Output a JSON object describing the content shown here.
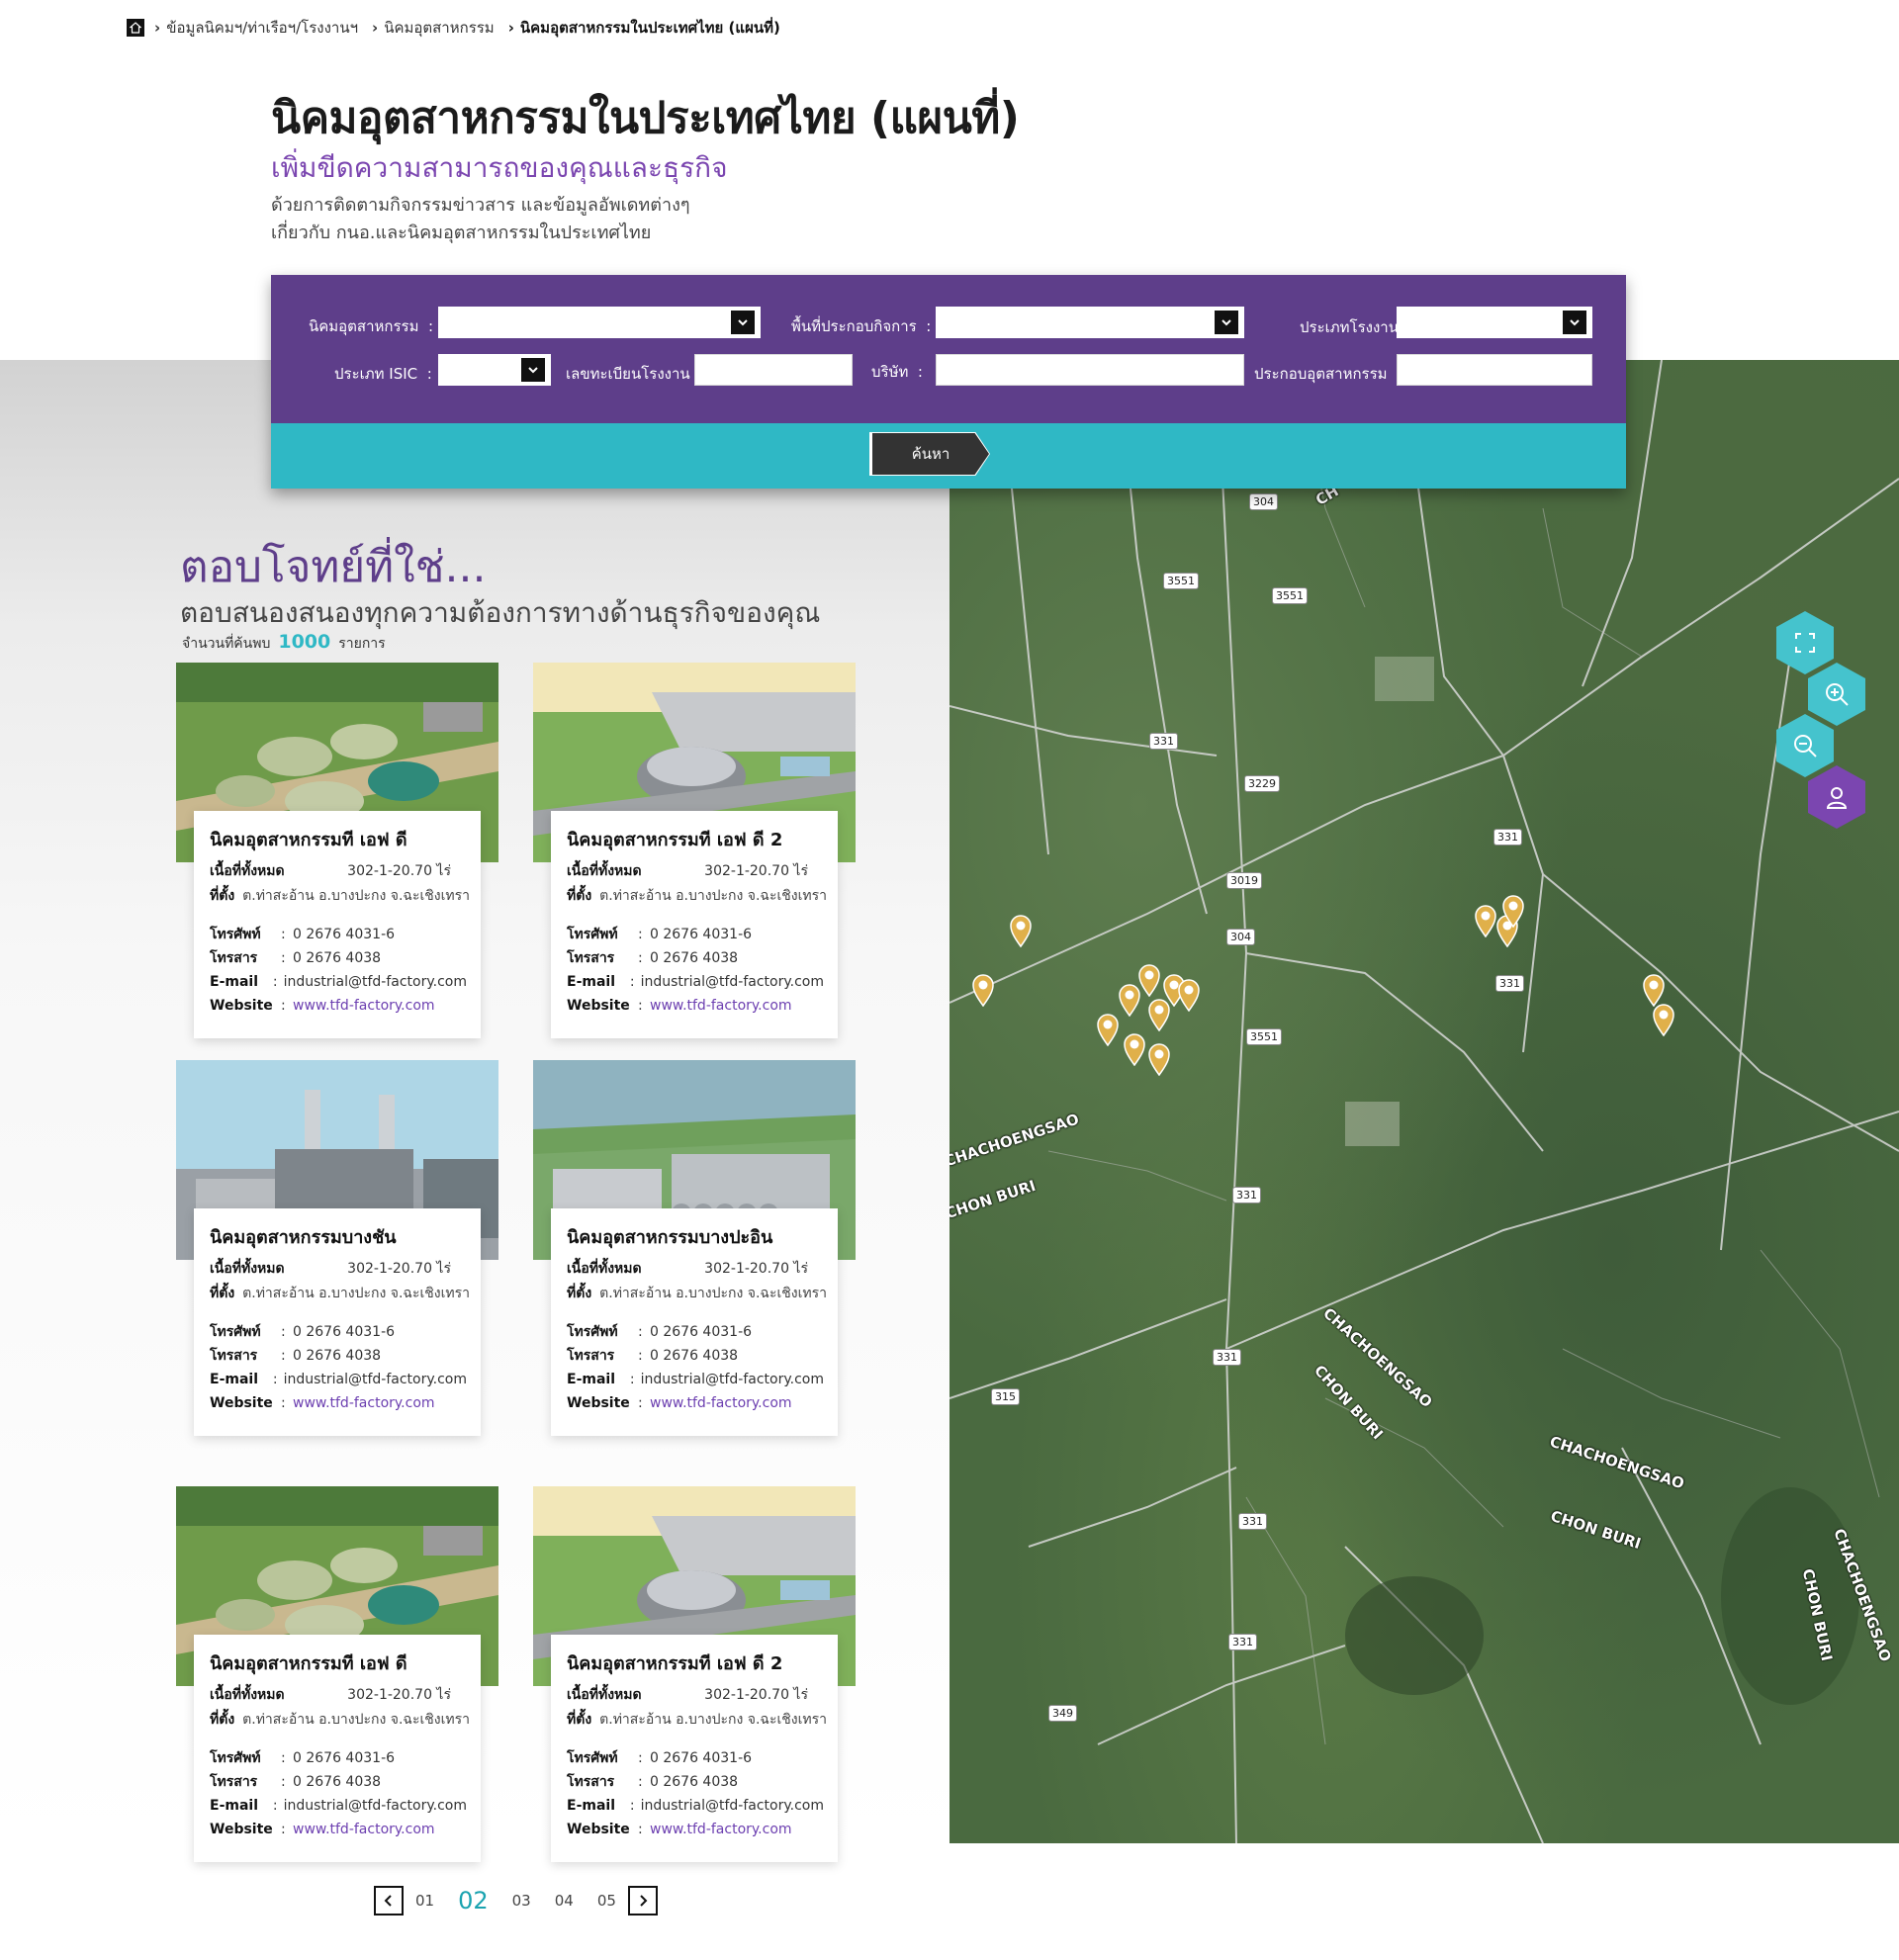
{
  "breadcrumb": {
    "items": [
      {
        "label": "ข้อมูลนิคมฯ/ท่าเรือฯ/โรงงานฯ"
      },
      {
        "label": "นิคมอุตสาหกรรม"
      },
      {
        "label": "นิคมอุตสาหกรรมในประเทศไทย (แผนที่)"
      }
    ]
  },
  "header": {
    "title": "นิคมอุตสาหกรรมในประเทศไทย (แผนที่)",
    "subtitle": "เพิ่มขีดความสามารถของคุณและธุรกิจ",
    "desc_line1": "ด้วยการติดตามกิจกรรมข่าวสาร และข้อมูลอัพเดทต่างๆ",
    "desc_line2": "เกี่ยวกับ กนอ.และนิคมอุตสาหกรรมในประเทศไทย"
  },
  "search": {
    "estate_label": "นิคมอุตสาหกรรม",
    "zone_label": "พื้นที่ประกอบกิจการ",
    "factory_type_label": "ประเภทโรงงาน",
    "isic_label": "ประเภท ISIC",
    "factory_reg_label": "เลขทะเบียนโรงงาน",
    "company_label": "บริษัท",
    "industry_label": "ประกอบอุตสาหกรรม",
    "colon": ":",
    "button_label": "ค้นหา"
  },
  "results": {
    "title": "ตอบโจทย์ที่ใช่...",
    "subtitle": "ตอบสนองสนองทุกความต้องการทางด้านธุรกิจของคุณ",
    "count_prefix": "จำนวนที่ค้นพบ",
    "count": "1000",
    "count_suffix": "รายการ"
  },
  "card_labels": {
    "area": "เนื้อที่ทั้งหมด",
    "location": "ที่ตั้ง",
    "phone": "โทรศัพท์",
    "fax": "โทรสาร",
    "email": "E-mail",
    "website": "Website",
    "sep": ":"
  },
  "cards": [
    {
      "name": "นิคมอุตสาหกรรมที เอฟ ดี",
      "area": "302-1-20.70 ไร่",
      "location": "ต.ท่าสะอ้าน อ.บางปะกง จ.ฉะเชิงเทรา",
      "phone": "0 2676 4031-6",
      "fax": "0 2676 4038",
      "email": "industrial@tfd-factory.com",
      "website": "www.tfd-factory.com"
    },
    {
      "name": "นิคมอุตสาหกรรมที เอฟ ดี 2",
      "area": "302-1-20.70 ไร่",
      "location": "ต.ท่าสะอ้าน อ.บางปะกง จ.ฉะเชิงเทรา",
      "phone": "0 2676 4031-6",
      "fax": "0 2676 4038",
      "email": "industrial@tfd-factory.com",
      "website": "www.tfd-factory.com"
    },
    {
      "name": "นิคมอุตสาหกรรมบางชัน",
      "area": "302-1-20.70 ไร่",
      "location": "ต.ท่าสะอ้าน อ.บางปะกง จ.ฉะเชิงเทรา",
      "phone": "0 2676 4031-6",
      "fax": "0 2676 4038",
      "email": "industrial@tfd-factory.com",
      "website": "www.tfd-factory.com"
    },
    {
      "name": "นิคมอุตสาหกรรมบางปะอิน",
      "area": "302-1-20.70 ไร่",
      "location": "ต.ท่าสะอ้าน อ.บางปะกง จ.ฉะเชิงเทรา",
      "phone": "0 2676 4031-6",
      "fax": "0 2676 4038",
      "email": "industrial@tfd-factory.com",
      "website": "www.tfd-factory.com"
    },
    {
      "name": "นิคมอุตสาหกรรมที เอฟ ดี",
      "area": "302-1-20.70 ไร่",
      "location": "ต.ท่าสะอ้าน อ.บางปะกง จ.ฉะเชิงเทรา",
      "phone": "0 2676 4031-6",
      "fax": "0 2676 4038",
      "email": "industrial@tfd-factory.com",
      "website": "www.tfd-factory.com"
    },
    {
      "name": "นิคมอุตสาหกรรมที เอฟ ดี 2",
      "area": "302-1-20.70 ไร่",
      "location": "ต.ท่าสะอ้าน อ.บางปะกง จ.ฉะเชิงเทรา",
      "phone": "0 2676 4031-6",
      "fax": "0 2676 4038",
      "email": "industrial@tfd-factory.com",
      "website": "www.tfd-factory.com"
    }
  ],
  "map": {
    "road_labels": [
      "304",
      "3551",
      "3551",
      "331",
      "3229",
      "331",
      "3019",
      "304",
      "331",
      "3551",
      "331",
      "331",
      "315",
      "331",
      "331",
      "349"
    ],
    "place_labels": [
      "CHACHOENGSAO",
      "CHON BURI",
      "CHACHOENGSAO",
      "CHON BURI",
      "CHACHOENGSAO",
      "CHON BURI",
      "CHACHOENGSAO",
      "CHON BURI",
      "CH"
    ],
    "controls": [
      "fullscreen-icon",
      "zoom-in-icon",
      "zoom-out-icon",
      "user-icon"
    ]
  },
  "pagination": {
    "pages": [
      "01",
      "02",
      "03",
      "04",
      "05"
    ],
    "active": "02"
  },
  "colors": {
    "purple": "#5e3e8a",
    "teal": "#2fb8c5",
    "accent_purple": "#7b46b0",
    "pin": "#e0b04a"
  }
}
